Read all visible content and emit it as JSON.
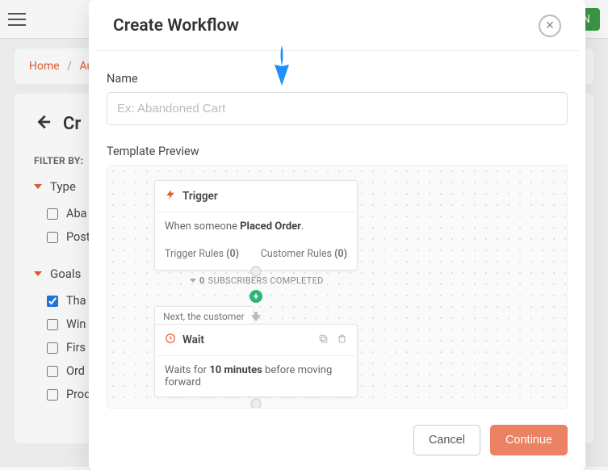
{
  "colors": {
    "accent": "#e05e2b",
    "primary_green": "#3a9b43",
    "node_green": "#2bb673",
    "arrow_blue": "#1e90ff",
    "continue": "#eb8263"
  },
  "topbar": {
    "upgrade_label": "Upgrade N"
  },
  "breadcrumb": {
    "home": "Home",
    "current": "Au"
  },
  "panel": {
    "title": "Cr",
    "filter_by_label": "FILTER BY:"
  },
  "filters": {
    "type": {
      "heading": "Type",
      "items": [
        "Aba",
        "Post"
      ]
    },
    "goals": {
      "heading": "Goals",
      "items": [
        "Tha",
        "Win",
        "Firs",
        "Ord",
        "Prod"
      ],
      "checked_index": 0
    }
  },
  "modal": {
    "title": "Create Workflow",
    "name_label": "Name",
    "name_placeholder": "Ex: Abandoned Cart",
    "template_preview_label": "Template Preview",
    "cancel_label": "Cancel",
    "continue_label": "Continue"
  },
  "preview": {
    "trigger": {
      "heading": "Trigger",
      "body_prefix": "When someone ",
      "body_bold": "Placed Order",
      "body_suffix": ".",
      "trigger_rules_label": "Trigger Rules",
      "trigger_rules_count": "(0)",
      "customer_rules_label": "Customer Rules",
      "customer_rules_count": "(0)"
    },
    "subscribers_line_count": "0",
    "subscribers_line_text": "SUBSCRIBERS COMPLETED",
    "next_text": "Next, the customer",
    "wait": {
      "heading": "Wait",
      "body_prefix": "Waits for ",
      "body_bold": "10 minutes",
      "body_suffix": " before moving forward"
    }
  }
}
